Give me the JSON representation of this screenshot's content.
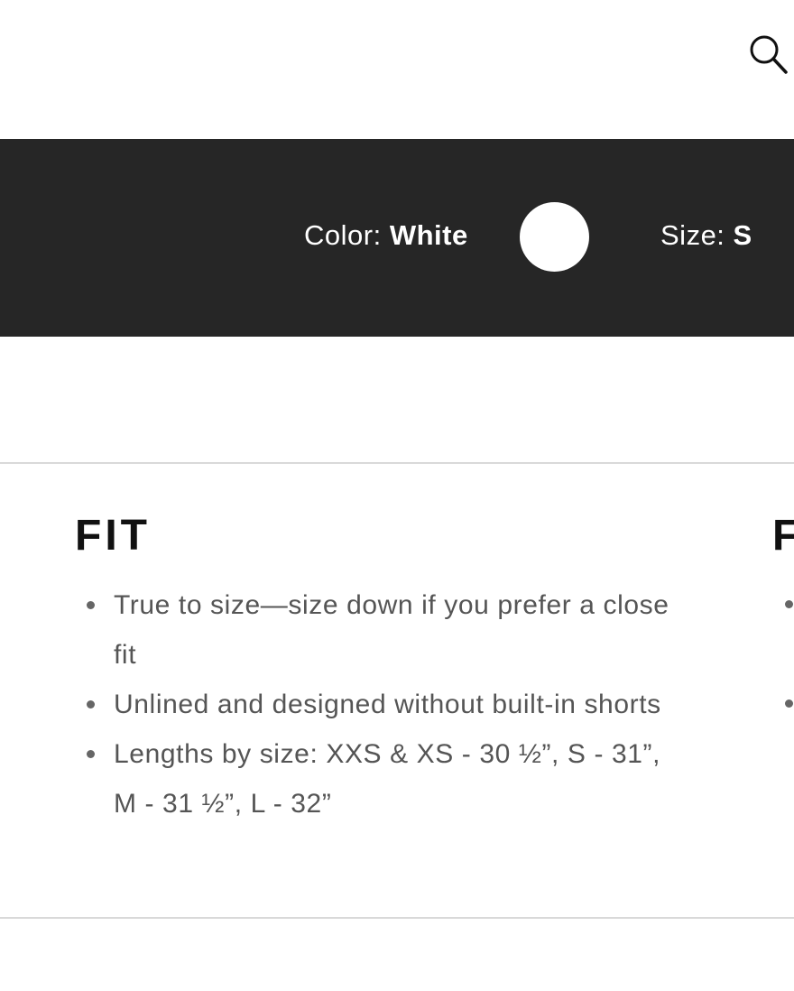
{
  "header": {
    "search_icon": "search-icon"
  },
  "variant_bar": {
    "color_label": "Color:",
    "color_value": "White",
    "swatch_color": "#ffffff",
    "size_label": "Size:",
    "size_value": "S",
    "background": "#262626"
  },
  "fit": {
    "title": "FIT",
    "items": [
      "True to size—size down if you prefer a close fit",
      "Unlined and designed without built-in shorts",
      "Lengths by size: XXS & XS - 30 ½”, S - 31”, M - 31 ½”, L - 32”"
    ]
  },
  "next_section": {
    "title_partial": "F"
  }
}
